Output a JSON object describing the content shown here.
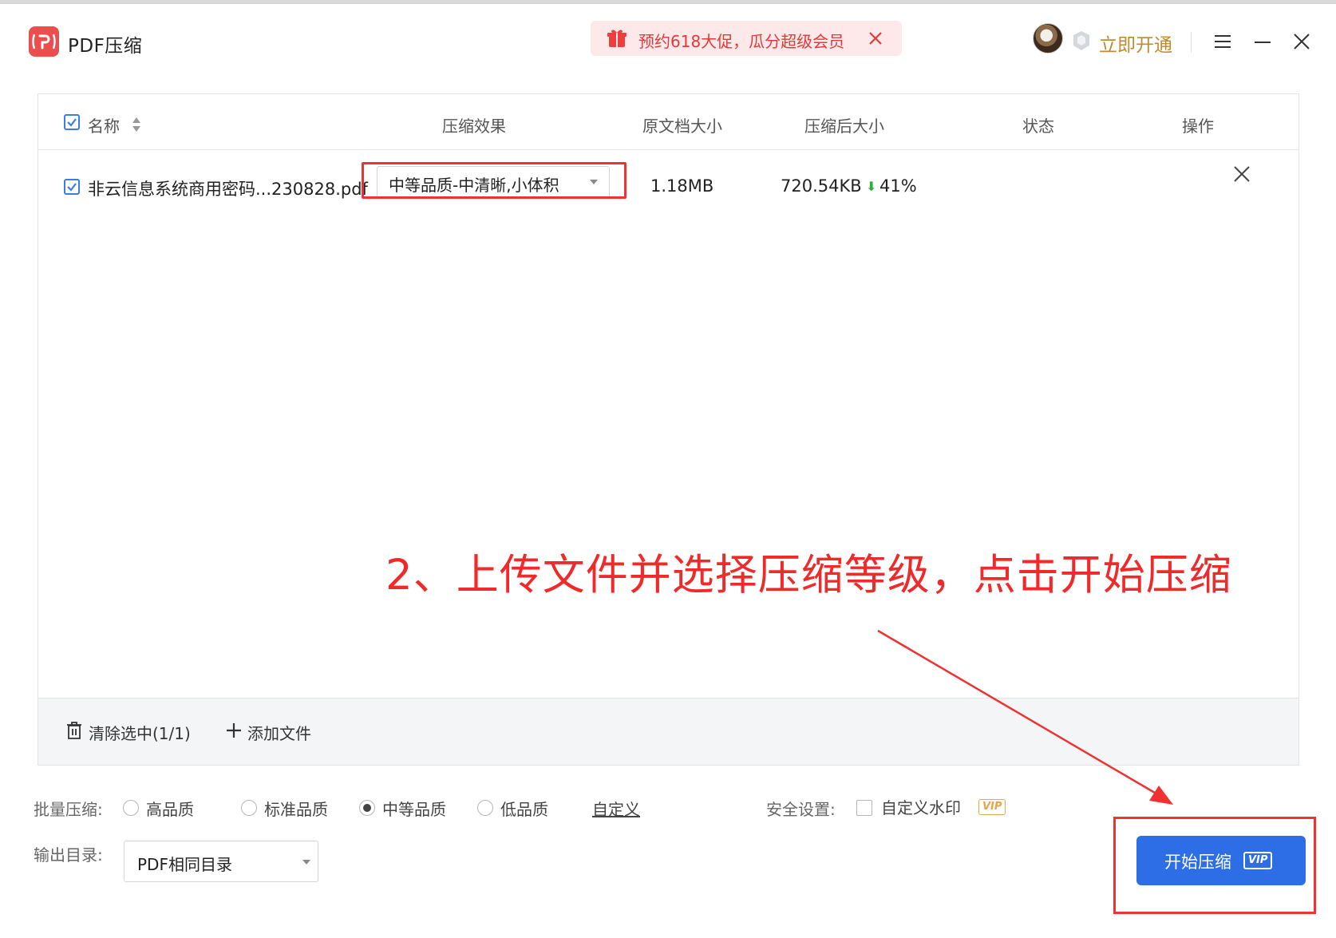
{
  "app": {
    "title": "PDF压缩",
    "promo_text": "预约618大促，瓜分超级会员",
    "open_vip": "立即开通",
    "accent_color": "#2d6ee6",
    "brand_color": "#ec4d4d"
  },
  "table": {
    "headers": {
      "name": "名称",
      "effect": "压缩效果",
      "original_size": "原文档大小",
      "compressed_size": "压缩后大小",
      "status": "状态",
      "action": "操作"
    },
    "rows": [
      {
        "checked": true,
        "file_name": "非云信息系统商用密码...230828.pdf",
        "quality": "中等品质-中清晰,小体积",
        "original_size": "1.18MB",
        "compressed_size": "720.54KB",
        "reduction": "41%",
        "status": ""
      }
    ],
    "footer": {
      "clear_selected": "清除选中(1/1)",
      "add_file": "添加文件"
    }
  },
  "annotation": {
    "text": "2、上传文件并选择压缩等级，点击开始压缩",
    "color": "#f02a2a"
  },
  "options": {
    "batch_label": "批量压缩:",
    "qualities": [
      {
        "label": "高品质",
        "selected": false
      },
      {
        "label": "标准品质",
        "selected": false
      },
      {
        "label": "中等品质",
        "selected": true
      },
      {
        "label": "低品质",
        "selected": false
      }
    ],
    "custom": "自定义",
    "security_label": "安全设置:",
    "watermark": "自定义水印",
    "watermark_vip": "VIP",
    "output_label": "输出目录:",
    "output_value": "PDF相同目录"
  },
  "start_button": {
    "label": "开始压缩",
    "vip": "VIP"
  },
  "icons": [
    "app-logo-icon",
    "gift-icon",
    "close-icon",
    "vip-shield-icon",
    "menu-icon",
    "minimize-icon",
    "checkbox-icon",
    "sort-icon",
    "trash-icon",
    "plus-icon",
    "dropdown-caret-icon",
    "down-arrow-icon"
  ]
}
